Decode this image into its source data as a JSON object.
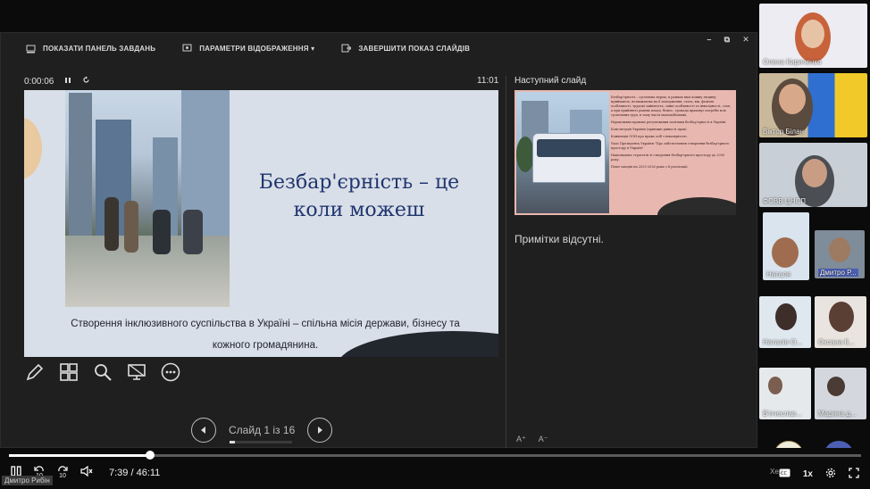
{
  "toolbar": {
    "show_taskbar": "ПОКАЗАТИ ПАНЕЛЬ ЗАВДАНЬ",
    "display_settings": "ПАРАМЕТРИ ВІДОБРАЖЕННЯ ▾",
    "end_show": "ЗАВЕРШИТИ ПОКАЗ СЛАЙДІВ",
    "window_controls": [
      "–",
      "⧉",
      "✕"
    ]
  },
  "presenter": {
    "elapsed": "0:00:06",
    "clock": "11:01",
    "next_slide_label": "Наступний слайд",
    "notes_text": "Примітки відсутні.",
    "slide_counter": "Слайд 1 із 16",
    "font_tools": [
      "A⁺",
      "A⁻"
    ]
  },
  "current_slide": {
    "title": "Безбар'єрність – це коли можеш",
    "subtitle": "Створення інклюзивного суспільства в Україні – спільна місія держави, бізнесу та кожного громадянина."
  },
  "next_slide": {
    "bullets": [
      "Безбар'єрність – суспільна норма, в рамках якої кожну людину приймають, незважаючи на її походження, стать, вік, фізичні особливості, трудові зайнятість, зайні особливості та інвалідності, стан, а при прийнятті рішень влада, бізнес, громада враховує потреби всіх суспільних груп, в тому числі маломобільних.",
      "Нормативно-правове регулювання політики безбар'єрності в Україні:",
      "Конституція України (принцип рівності прав).",
      "Конвенція ООН про права осіб з інвалідністю.",
      "Указ Президента України \"Про забезпечення створення безбар'єрного простору в Україні\".",
      "Національна стратегія зі створення безбар'єрного простору до 2030 року.",
      "План заходів на 2025-2026 роки з її реалізації."
    ]
  },
  "participants": [
    {
      "name": "Олена Кириченко",
      "bg": "#e9e9ef"
    },
    {
      "name": "Віктор Білан",
      "bg": "#6b8bb0"
    },
    {
      "name": "ФСВВ ЦНСП",
      "bg": "#cdd2d8"
    },
    {
      "name": "Наталя",
      "bg": "#d9e4ee"
    },
    {
      "name": "Дмитро Р...",
      "bg": "#7f8c99"
    },
    {
      "name": "Наталія О...",
      "bg": "#dfe7ef"
    },
    {
      "name": "Оксана К...",
      "bg": "#e9e4df"
    },
    {
      "name": "В'ячеслав...",
      "bg": "#e6e9ec"
    },
    {
      "name": "Марина д...",
      "bg": "#d4d8de"
    }
  ],
  "player": {
    "time": "7:39 / 46:11",
    "skip_back": "10",
    "skip_fwd": "10",
    "speed": "1x",
    "progress": 0.166,
    "speaker_tag": "Дмитро Рибін",
    "more_participants": "+7",
    "cut_name": "Хер"
  }
}
